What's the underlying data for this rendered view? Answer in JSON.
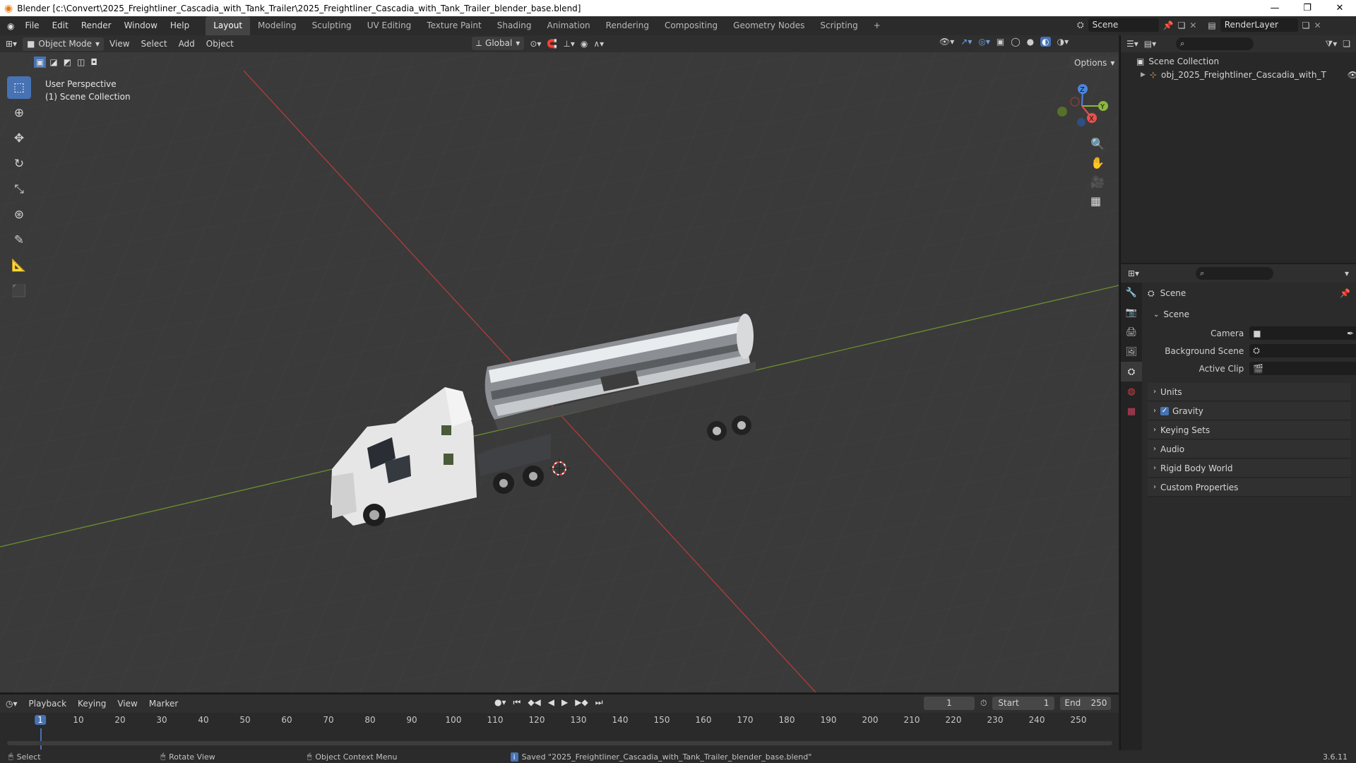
{
  "window": {
    "title": "Blender [c:\\Convert\\2025_Freightliner_Cascadia_with_Tank_Trailer\\2025_Freightliner_Cascadia_with_Tank_Trailer_blender_base.blend]"
  },
  "menubar": {
    "menus": [
      "File",
      "Edit",
      "Render",
      "Window",
      "Help"
    ],
    "workspaces": [
      "Layout",
      "Modeling",
      "Sculpting",
      "UV Editing",
      "Texture Paint",
      "Shading",
      "Animation",
      "Rendering",
      "Compositing",
      "Geometry Nodes",
      "Scripting"
    ],
    "active_workspace": "Layout",
    "scene_name": "Scene",
    "view_layer": "RenderLayer"
  },
  "viewport_header": {
    "mode": "Object Mode",
    "menus": [
      "View",
      "Select",
      "Add",
      "Object"
    ],
    "transform_orientation": "Global",
    "options_label": "Options"
  },
  "viewport": {
    "overlay_line1": "User Perspective",
    "overlay_line2": "(1) Scene Collection",
    "gizmo_axes": [
      "Z",
      "Y",
      "X"
    ]
  },
  "outliner": {
    "root": "Scene Collection",
    "items": [
      {
        "label": "obj_2025_Freightliner_Cascadia_with_T"
      }
    ]
  },
  "properties": {
    "header_title": "Scene",
    "section_title": "Scene",
    "fields": [
      {
        "label": "Camera",
        "value": ""
      },
      {
        "label": "Background Scene",
        "value": ""
      },
      {
        "label": "Active Clip",
        "value": ""
      }
    ],
    "panels": [
      "Units",
      "Gravity",
      "Keying Sets",
      "Audio",
      "Rigid Body World",
      "Custom Properties"
    ],
    "gravity_checked": true
  },
  "timeline": {
    "menus": [
      "Playback",
      "Keying",
      "View",
      "Marker"
    ],
    "current_frame": "1",
    "start_label": "Start",
    "start_value": "1",
    "end_label": "End",
    "end_value": "250",
    "ticks": [
      "1",
      "10",
      "20",
      "30",
      "40",
      "50",
      "60",
      "70",
      "80",
      "90",
      "100",
      "110",
      "120",
      "130",
      "140",
      "150",
      "160",
      "170",
      "180",
      "190",
      "200",
      "210",
      "220",
      "230",
      "240",
      "250"
    ]
  },
  "statusbar": {
    "select": "Select",
    "rotate": "Rotate View",
    "context": "Object Context Menu",
    "message": "Saved \"2025_Freightliner_Cascadia_with_Tank_Trailer_blender_base.blend\"",
    "version": "3.6.11"
  },
  "colors": {
    "accent": "#4772b3",
    "x_axis": "#e8504f",
    "y_axis": "#8cb83b",
    "z_axis": "#4d86e0"
  }
}
